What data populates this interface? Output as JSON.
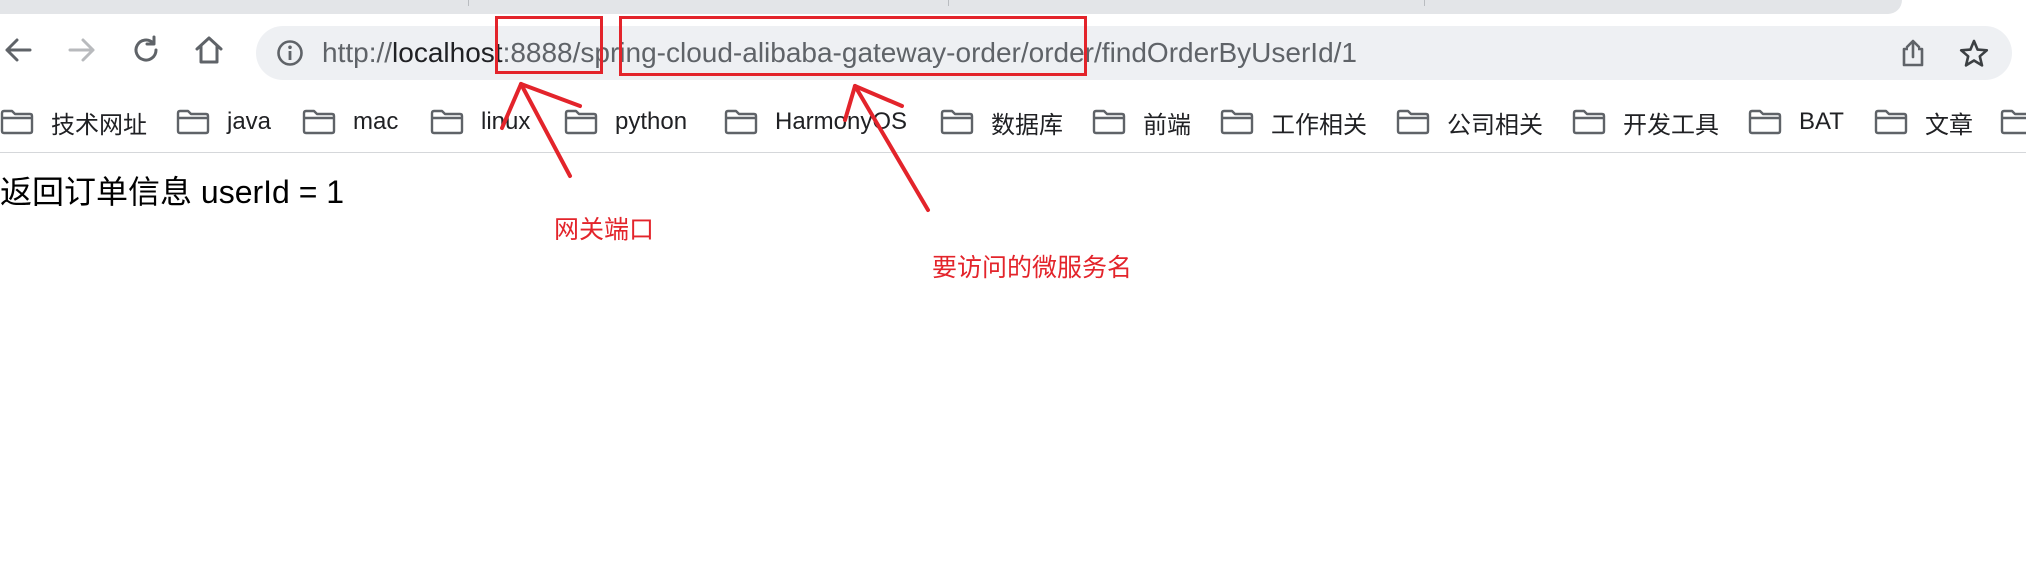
{
  "toolbar": {
    "back_icon": "back-arrow-icon",
    "forward_icon": "forward-arrow-icon",
    "reload_icon": "reload-icon",
    "home_icon": "home-icon"
  },
  "omnibox": {
    "info_icon": "info-icon",
    "url_scheme": "http://",
    "url_host": "localhost",
    "url_rest": ":8888/spring-cloud-alibaba-gateway-order/order/findOrderByUserId/1",
    "share_icon": "share-icon",
    "star_icon": "bookmark-star-icon"
  },
  "bookmarks": [
    {
      "label": "技术网址"
    },
    {
      "label": "java"
    },
    {
      "label": "mac"
    },
    {
      "label": "linux"
    },
    {
      "label": "python"
    },
    {
      "label": "HarmonyOS"
    },
    {
      "label": "数据库"
    },
    {
      "label": "前端"
    },
    {
      "label": "工作相关"
    },
    {
      "label": "公司相关"
    },
    {
      "label": "开发工具"
    },
    {
      "label": "BAT"
    },
    {
      "label": "文章"
    }
  ],
  "page": {
    "response_text": "返回订单信息 userId = 1"
  },
  "annotations": {
    "port_label": "网关端口",
    "service_label": "要访问的微服务名",
    "color": "#e3242b"
  }
}
